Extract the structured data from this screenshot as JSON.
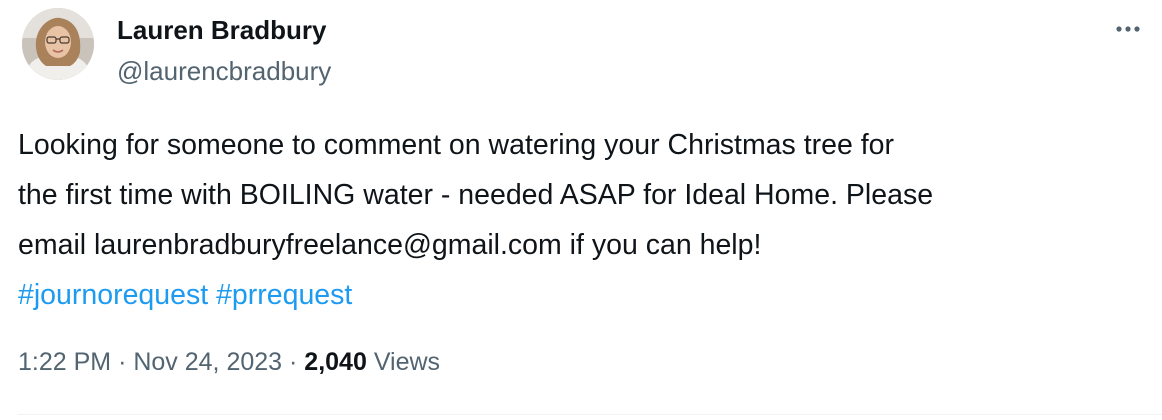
{
  "author": {
    "display_name": "Lauren Bradbury",
    "handle": "@laurencbradbury"
  },
  "tweet": {
    "lines": [
      "Looking for someone to comment on watering your Christmas tree for",
      "the first time with BOILING water - needed ASAP for Ideal Home. Please",
      "email laurenbradburyfreelance@gmail.com if you can help!"
    ],
    "hashtags": [
      "#journorequest",
      "#prrequest"
    ]
  },
  "meta": {
    "time": "1:22 PM",
    "separator": "·",
    "date": "Nov 24, 2023",
    "views_count": "2,040",
    "views_label": "Views"
  },
  "icons": {
    "more": "more-dots-icon",
    "avatar": "avatar-photo"
  },
  "colors": {
    "link": "#1d9bf0",
    "text_primary": "#0f1419",
    "text_secondary": "#536471"
  }
}
